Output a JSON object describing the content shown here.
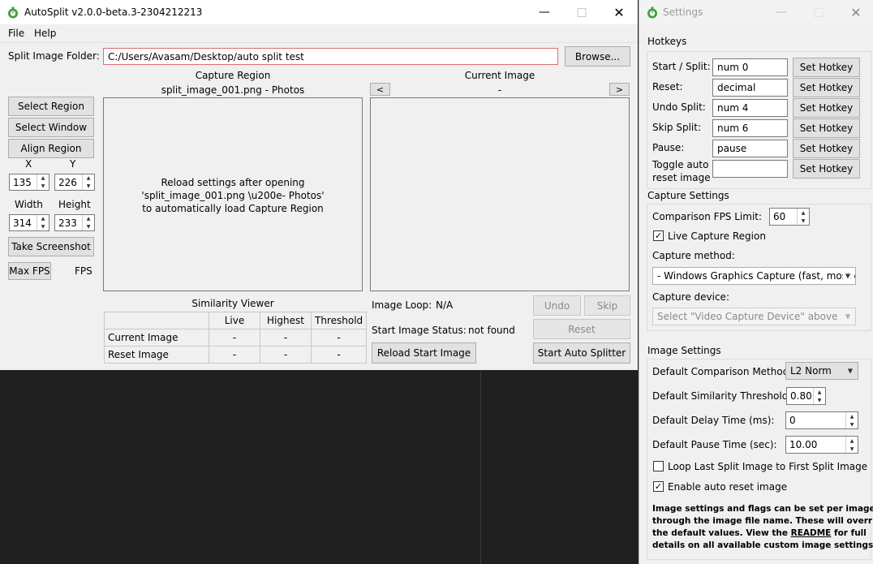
{
  "main_window": {
    "title": "AutoSplit v2.0.0-beta.3-2304212213",
    "menu": [
      "File",
      "Help"
    ],
    "split_folder_label": "Split Image Folder:",
    "split_folder_value": "C:/Users/Avasam/Desktop/auto split test",
    "browse_label": "Browse...",
    "capture_region_title": "Capture Region",
    "capture_region_subtitle": "split_image_001.png - Photos",
    "capture_region_message_1": "Reload settings after opening",
    "capture_region_message_2": "'split_image_001.png \\u200e- Photos'",
    "capture_region_message_3": "to automatically load Capture Region",
    "current_image_title": "Current Image",
    "current_image_subtitle": "-",
    "prev_label": "<",
    "next_label": ">",
    "select_region_label": "Select Region",
    "select_window_label": "Select Window",
    "align_region_label": "Align Region",
    "x_label": "X",
    "y_label": "Y",
    "x_value": "135",
    "y_value": "226",
    "width_label": "Width",
    "height_label": "Height",
    "width_value": "314",
    "height_value": "233",
    "take_screenshot_label": "Take Screenshot",
    "max_fps_label": "Max FPS",
    "fps_label": "FPS",
    "similarity_viewer_title": "Similarity Viewer",
    "similarity_headers": [
      "Live",
      "Highest",
      "Threshold"
    ],
    "similarity_rows": [
      {
        "label": "Current Image",
        "live": "-",
        "highest": "-",
        "threshold": "-"
      },
      {
        "label": "Reset Image",
        "live": "-",
        "highest": "-",
        "threshold": "-"
      }
    ],
    "image_loop_label": "Image Loop:",
    "image_loop_value": "N/A",
    "start_image_status_label": "Start Image Status:",
    "start_image_status_value": "not found",
    "reload_start_image_label": "Reload Start Image",
    "undo_label": "Undo",
    "skip_label": "Skip",
    "reset_label": "Reset",
    "start_auto_splitter_label": "Start Auto Splitter"
  },
  "settings_window": {
    "title": "Settings",
    "hotkeys_title": "Hotkeys",
    "hotkeys": [
      {
        "label": "Start / Split:",
        "value": "num 0",
        "button": "Set Hotkey"
      },
      {
        "label": "Reset:",
        "value": "decimal",
        "button": "Set Hotkey"
      },
      {
        "label": "Undo Split:",
        "value": "num 4",
        "button": "Set Hotkey"
      },
      {
        "label": "Skip Split:",
        "value": "num 6",
        "button": "Set Hotkey"
      },
      {
        "label": "Pause:",
        "value": "pause",
        "button": "Set Hotkey"
      },
      {
        "label_1": "Toggle auto",
        "label_2": "reset image",
        "value": "",
        "button": "Set Hotkey"
      }
    ],
    "capture_settings_title": "Capture Settings",
    "fps_limit_label": "Comparison FPS Limit:",
    "fps_limit_value": "60",
    "live_capture_label": "Live Capture Region",
    "live_capture_checked": true,
    "capture_method_label": "Capture method:",
    "capture_method_value": "- Windows Graphics Capture (fast, most cc",
    "capture_device_label": "Capture device:",
    "capture_device_value": "Select \"Video Capture Device\" above",
    "image_settings_title": "Image Settings",
    "comparison_method_label": "Default Comparison Method:",
    "comparison_method_value": "L2 Norm",
    "similarity_threshold_label": "Default Similarity Threshold:",
    "similarity_threshold_value": "0.80",
    "delay_time_label": "Default Delay Time (ms):",
    "delay_time_value": "0",
    "pause_time_label": "Default Pause Time (sec):",
    "pause_time_value": "10.00",
    "loop_label": "Loop Last Split Image to First Split Image",
    "loop_checked": false,
    "enable_reset_label": "Enable auto reset image",
    "enable_reset_checked": true,
    "info_text_1": "Image settings and flags can be set per image",
    "info_text_2": "through the image file name. These will override",
    "info_text_3": "the default values. View the",
    "info_link": "README",
    "info_text_4": "for full",
    "info_text_5": "details on all available custom image settings."
  },
  "colors": {
    "app_icon": "#3fa33f",
    "window_bg": "#f0f0f0",
    "desktop_bg": "#202020",
    "field_error_border": "#e06c75"
  },
  "icons": {
    "minimize": "minimize-icon",
    "maximize": "maximize-icon",
    "close": "close-icon",
    "app": "app-icon",
    "checkmark": "check-icon",
    "dropdown": "chevron-down-icon"
  }
}
